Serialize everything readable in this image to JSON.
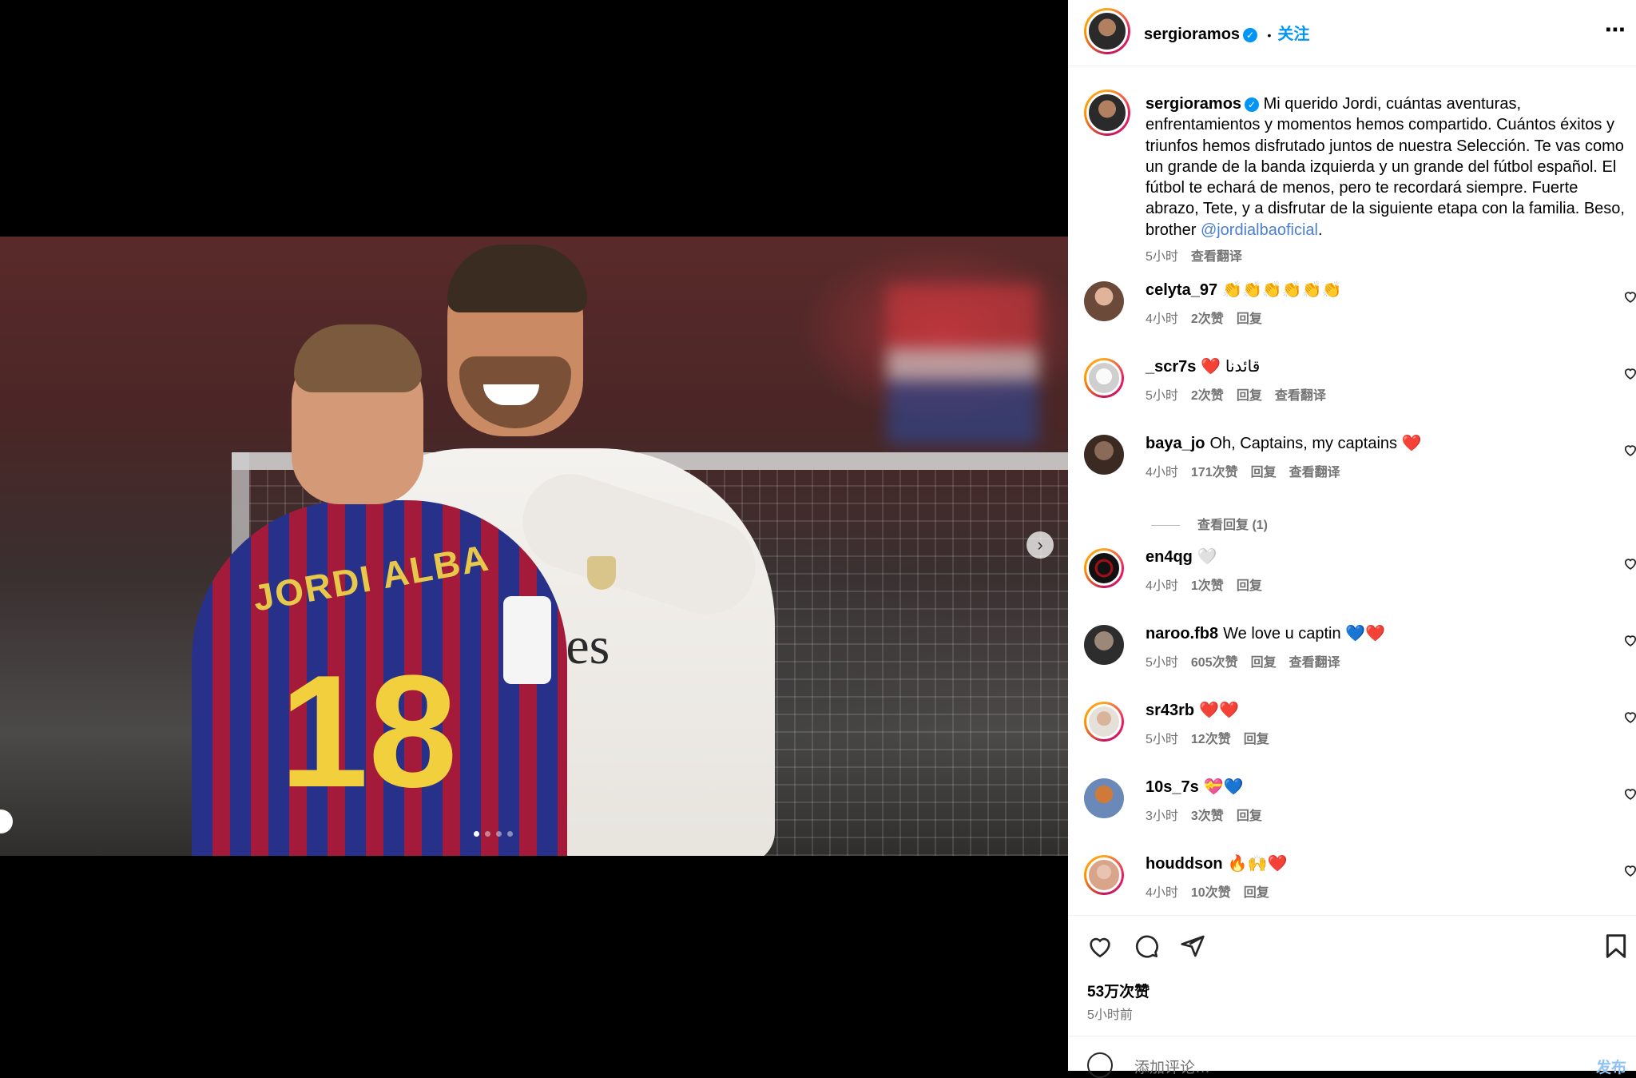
{
  "post": {
    "author": "sergioramos",
    "follow_label": "关注",
    "separator": "•",
    "more_icon": "more-icon",
    "caption_text": "Mi querido Jordi, cuántas aventuras, enfrentamientos y momentos hemos compartido. Cuántos éxitos y triunfos hemos disfrutado juntos de nuestra Selección. Te vas como un grande de la banda izquierda y un grande del fútbol español. El fútbol te echará de menos, pero te recordará siempre. Fuerte abrazo, Tete, y a disfrutar de la siguiente etapa con la familia. Beso, brother",
    "caption_mention": "@jordialbaoficial",
    "caption_period": ".",
    "caption_time": "5小时",
    "caption_translate": "查看翻译",
    "likes": "53万次赞",
    "posted_ago": "5小时前",
    "carousel": {
      "slide_count": 4,
      "active_index": 0
    }
  },
  "comments": [
    {
      "user": "celyta_97",
      "text": "👏👏👏👏👏👏",
      "time": "4小时",
      "likes": "2次赞",
      "reply": "回复",
      "translate": ""
    },
    {
      "user": "_scr7s",
      "text": "❤️ قائدنا",
      "time": "5小时",
      "likes": "2次赞",
      "reply": "回复",
      "translate": "查看翻译"
    },
    {
      "user": "baya_jo",
      "text": "Oh, Captains, my captains ❤️",
      "time": "4小时",
      "likes": "171次赞",
      "reply": "回复",
      "translate": "查看翻译"
    },
    {
      "user": "en4qg",
      "text": "🤍",
      "time": "4小时",
      "likes": "1次赞",
      "reply": "回复",
      "translate": ""
    },
    {
      "user": "naroo.fb8",
      "text": "We love u captin 💙❤️",
      "time": "5小时",
      "likes": "605次赞",
      "reply": "回复",
      "translate": "查看翻译"
    },
    {
      "user": "sr43rb",
      "text": "❤️❤️",
      "time": "5小时",
      "likes": "12次赞",
      "reply": "回复",
      "translate": ""
    },
    {
      "user": "10s_7s",
      "text": "💝💙",
      "time": "3小时",
      "likes": "3次赞",
      "reply": "回复",
      "translate": ""
    },
    {
      "user": "houddson",
      "text": "🔥🙌❤️",
      "time": "4小时",
      "likes": "10次赞",
      "reply": "回复",
      "translate": ""
    }
  ],
  "view_replies": "查看回复 (1)",
  "add_comment": {
    "placeholder": "添加评论…",
    "post_label": "发布"
  },
  "photo_text": {
    "jersey_name": "JORDI ALBA",
    "jersey_number": "18",
    "sponsor": "tes"
  },
  "colors": {
    "accent": "#0095f6",
    "text": "#000000",
    "muted": "#737373"
  }
}
